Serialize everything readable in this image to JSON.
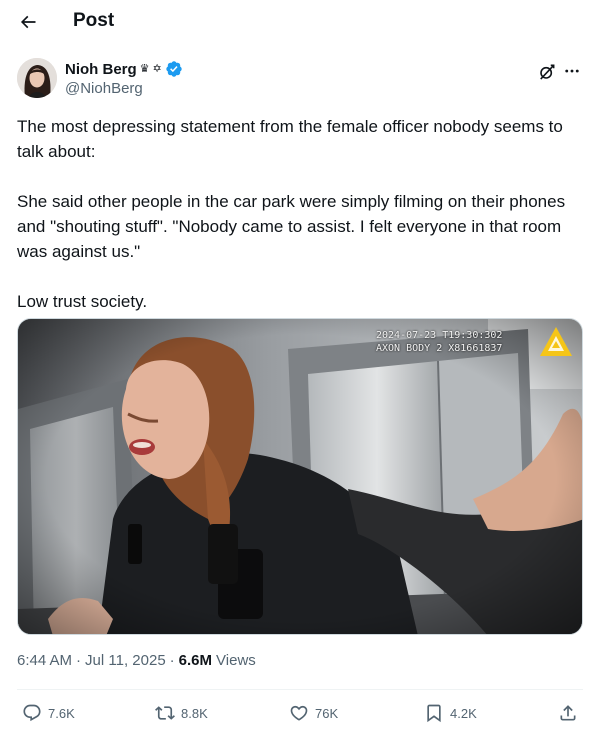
{
  "header": {
    "title": "Post",
    "back_icon": "arrow-left-icon"
  },
  "author": {
    "display_name": "Nioh Berg",
    "handle": "@NiohBerg",
    "emoji_crown": "♛",
    "emoji_star": "✡",
    "verified_color": "#1d9bf0"
  },
  "tweet": {
    "paragraphs": [
      "The most depressing statement from the female officer nobody seems to talk about:",
      "She said other people in the car park were simply filming on their phones and \"shouting stuff\". \"Nobody came to assist. I felt everyone in that room was against us.\"",
      "Low trust society."
    ]
  },
  "media": {
    "timestamp_line1": "2024-07-23 T19:30:302",
    "timestamp_line2": "AXON BODY 2 X81661837",
    "logo_color": "#f5c518"
  },
  "meta": {
    "time": "6:44 AM",
    "date": "Jul 11, 2025",
    "separator": "·",
    "views_count": "6.6M",
    "views_label": "Views"
  },
  "actions": {
    "replies": "7.6K",
    "reposts": "8.8K",
    "likes": "76K",
    "bookmarks": "4.2K"
  },
  "colors": {
    "text_primary": "#0f1419",
    "text_secondary": "#536471",
    "divider": "#eff3f4",
    "accent": "#1d9bf0"
  }
}
